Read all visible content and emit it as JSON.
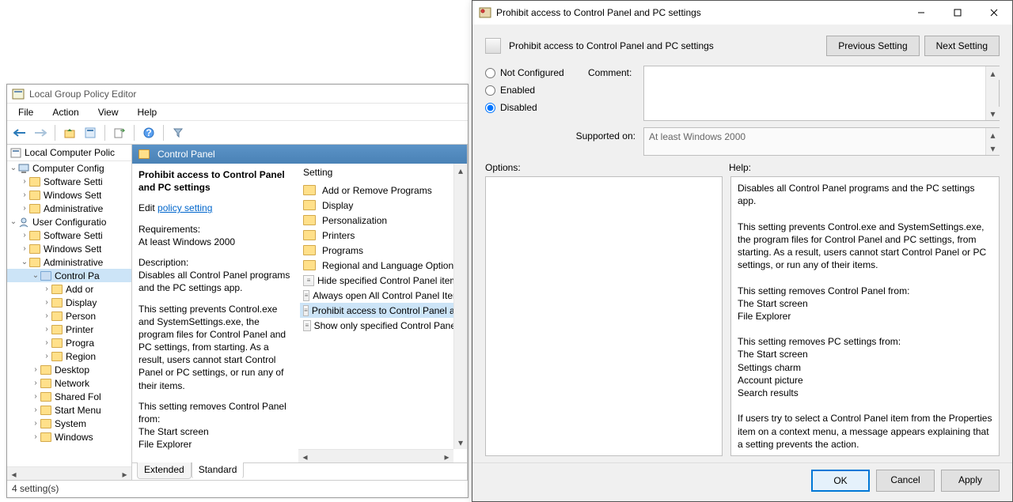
{
  "gpe": {
    "title": "Local Group Policy Editor",
    "menu": [
      "File",
      "Action",
      "View",
      "Help"
    ],
    "tree_root": "Local Computer Polic",
    "tree": {
      "cc": "Computer Config",
      "cc_soft": "Software Setti",
      "cc_win": "Windows Sett",
      "cc_admin": "Administrative",
      "uc": "User Configuratio",
      "uc_soft": "Software Setti",
      "uc_win": "Windows Sett",
      "uc_admin": "Administrative",
      "cp": "Control Pa",
      "cp_add": "Add or",
      "cp_disp": "Display",
      "cp_pers": "Person",
      "cp_prn": "Printer",
      "cp_prog": "Progra",
      "cp_reg": "Region",
      "desk": "Desktop",
      "net": "Network",
      "shf": "Shared Fol",
      "sm": "Start Menu",
      "sys": "System",
      "winc": "Windows"
    },
    "mid_title": "Control Panel",
    "desc": {
      "title": "Prohibit access to Control Panel and PC settings",
      "edit": "Edit ",
      "link": "policy setting ",
      "req_h": "Requirements:",
      "req": "At least Windows 2000",
      "d_h": "Description:",
      "d1": "Disables all Control Panel programs and the PC settings app.",
      "d2": "This setting prevents Control.exe and SystemSettings.exe, the program files for Control Panel and PC settings, from starting. As a result, users cannot start Control Panel or PC settings, or run any of their items.",
      "d3": "This setting removes Control Panel from:",
      "d4": "The Start screen",
      "d5": "File Explorer"
    },
    "list_head": "Setting",
    "list": {
      "folders": [
        "Add or Remove Programs",
        "Display",
        "Personalization",
        "Printers",
        "Programs",
        "Regional and Language Options"
      ],
      "policies": [
        "Hide specified Control Panel items",
        "Always open All Control Panel Items",
        "Prohibit access to Control Panel and",
        "Show only specified Control Panel it"
      ]
    },
    "tabs": {
      "ext": "Extended",
      "std": "Standard"
    },
    "status": "4 setting(s)"
  },
  "dlg": {
    "title": "Prohibit access to Control Panel and PC settings",
    "head": "Prohibit access to Control Panel and PC settings",
    "prev": "Previous Setting",
    "next": "Next Setting",
    "nc": "Not Configured",
    "en": "Enabled",
    "dis": "Disabled",
    "comment": "Comment:",
    "sup_lbl": "Supported on:",
    "sup": "At least Windows 2000",
    "opt_lbl": "Options:",
    "help_lbl": "Help:",
    "help": {
      "p1": "Disables all Control Panel programs and the PC settings app.",
      "p2": "This setting prevents Control.exe and SystemSettings.exe, the program files for Control Panel and PC settings, from starting. As a result, users cannot start Control Panel or PC settings, or run any of their items.",
      "p3": "This setting removes Control Panel from:",
      "p3a": "The Start screen",
      "p3b": "File Explorer",
      "p4": "This setting removes PC settings from:",
      "p4a": "The Start screen",
      "p4b": "Settings charm",
      "p4c": "Account picture",
      "p4d": "Search results",
      "p5": "If users try to select a Control Panel item from the Properties item on a context menu, a message appears explaining that a setting prevents the action."
    },
    "ok": "OK",
    "cancel": "Cancel",
    "apply": "Apply"
  }
}
